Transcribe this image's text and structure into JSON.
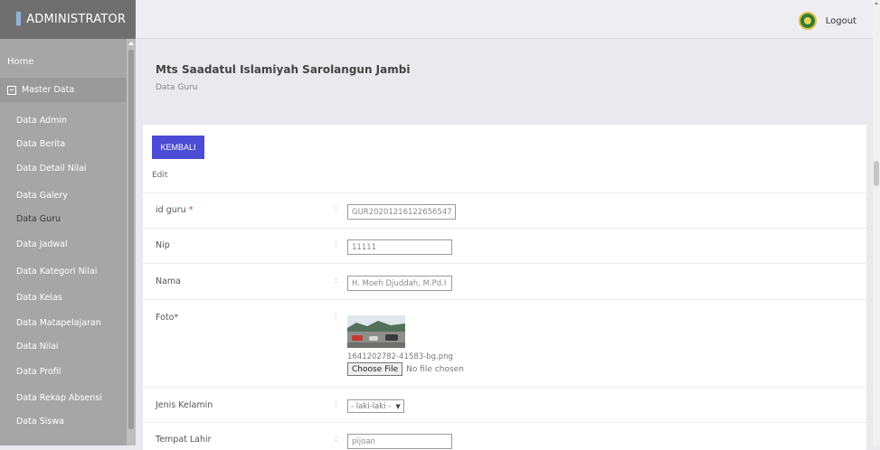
{
  "brand": {
    "title": "ADMINISTRATOR"
  },
  "topbar": {
    "logout_label": "Logout",
    "logo_icon": "school-emblem-icon"
  },
  "sidebar": {
    "home": "Home",
    "master": "Master Data",
    "items": [
      "Data Admin",
      "Data Berita",
      "Data Detail Nilai",
      "Data Galery",
      "Data Guru",
      "Data Jadwal",
      "Data Kategori Nilai",
      "Data Kelas",
      "Data Matapelajaran",
      "Data Nilai",
      "Data Profil",
      "Data Rekap Absensi",
      "Data Siswa"
    ],
    "active_item": "Data Guru"
  },
  "header": {
    "school": "Mts Saadatul Islamiyah Sarolangun Jambi",
    "crumb": "Data Guru"
  },
  "actions": {
    "back_label": "KEMBALI",
    "mode_label": "Edit"
  },
  "form": {
    "colon": ":",
    "id_guru": {
      "label": "id guru",
      "required": "*",
      "value": "GUR20201216122656547"
    },
    "nip": {
      "label": "Nip",
      "value": "11111"
    },
    "nama": {
      "label": "Nama",
      "value": "H. Moeh Djuddah, M.Pd.I"
    },
    "foto": {
      "label": "Foto*",
      "filename": "1641202782-41583-bg.png",
      "choose_label": "Choose File",
      "no_file": "No file chosen"
    },
    "jenis_kelamin": {
      "label": "Jenis Kelamin",
      "selected": "- laki-laki -"
    },
    "tempat_lahir": {
      "label": "Tempat Lahir",
      "value": "pijoan"
    }
  },
  "colors": {
    "sidebar": "#a6a6a6",
    "brand_bar": "#6f6f6f",
    "button": "#4b4bd6",
    "required": "#e04040"
  }
}
